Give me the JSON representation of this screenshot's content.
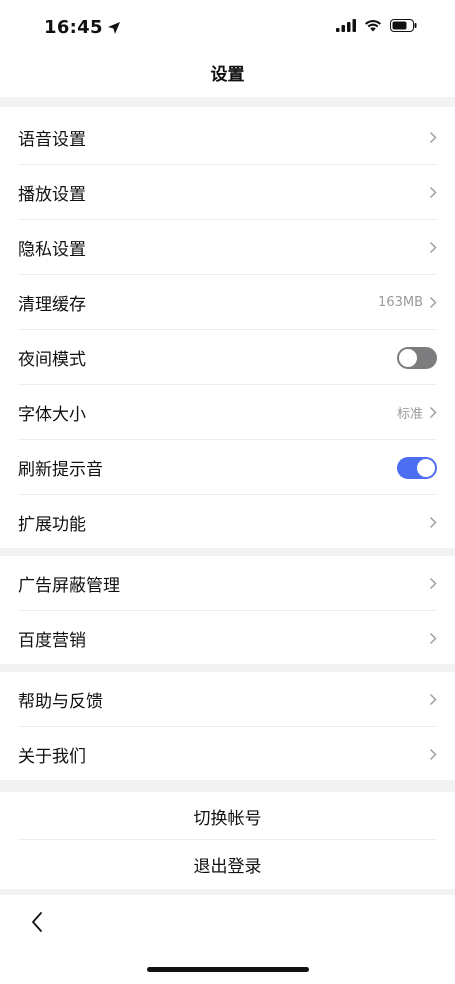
{
  "status_bar": {
    "time": "16:45"
  },
  "header": {
    "title": "设置"
  },
  "group1": [
    {
      "label": "语音设置"
    },
    {
      "label": "播放设置"
    },
    {
      "label": "隐私设置"
    },
    {
      "label": "清理缓存",
      "value": "163MB"
    },
    {
      "label": "夜间模式",
      "toggle": "off"
    },
    {
      "label": "字体大小",
      "value": "标准"
    },
    {
      "label": "刷新提示音",
      "toggle": "on"
    },
    {
      "label": "扩展功能"
    }
  ],
  "group2": [
    {
      "label": "广告屏蔽管理"
    },
    {
      "label": "百度营销"
    }
  ],
  "group3": [
    {
      "label": "帮助与反馈"
    },
    {
      "label": "关于我们"
    }
  ],
  "account": {
    "switch_label": "切换帐号",
    "logout_label": "退出登录"
  },
  "colors": {
    "accent": "#4e6ef2",
    "toggle_off": "#7d7d80",
    "section_gap": "#f2f2f2"
  }
}
